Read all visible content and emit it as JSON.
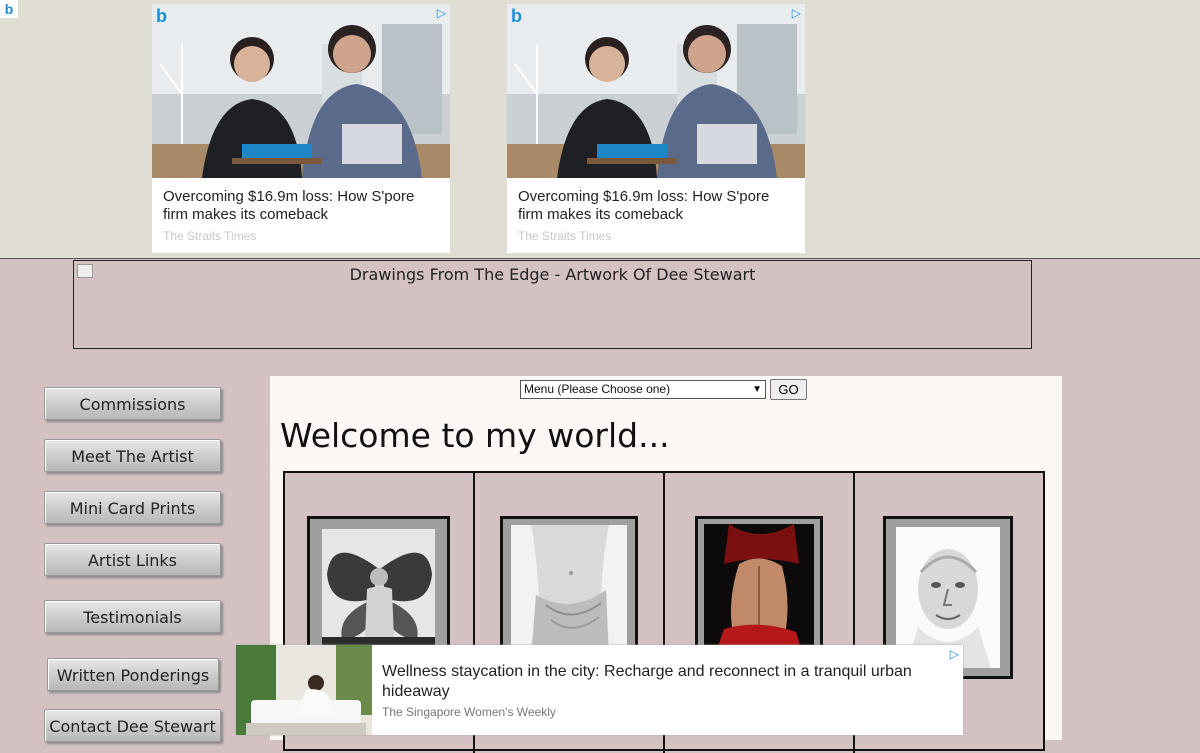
{
  "ads": {
    "corner_badge": "b",
    "cards": [
      {
        "brand_icon": "b",
        "title": "Overcoming $16.9m loss: How S'pore firm makes its comeback",
        "source": "The Straits Times"
      },
      {
        "brand_icon": "b",
        "title": "Overcoming $16.9m loss: How S'pore firm makes its comeback",
        "source": "The Straits Times"
      }
    ],
    "bottom": {
      "title": "Wellness staycation in the city: Recharge and reconnect in a tranquil urban hideaway",
      "source": "The Singapore Women's Weekly"
    },
    "adchoices_icon": "▷"
  },
  "banner": {
    "alt_text": "Drawings From The Edge - Artwork Of Dee Stewart"
  },
  "sidebar": {
    "items": [
      {
        "label": "Commissions"
      },
      {
        "label": "Meet The Artist"
      },
      {
        "label": "Mini Card Prints"
      },
      {
        "label": "Artist Links"
      },
      {
        "label": "Testimonials"
      },
      {
        "label": "Written Ponderings"
      },
      {
        "label": "Contact Dee Stewart"
      }
    ]
  },
  "main": {
    "menu_select": {
      "selected": "Menu (Please Choose one)"
    },
    "go_label": "GO",
    "heading": "Welcome to my world..."
  },
  "colors": {
    "page_bg": "#d4c1c2",
    "ad_strip_bg": "#e0ddd2",
    "panel_bg": "#fdf8f5",
    "accent_blue": "#1a8fd8"
  }
}
